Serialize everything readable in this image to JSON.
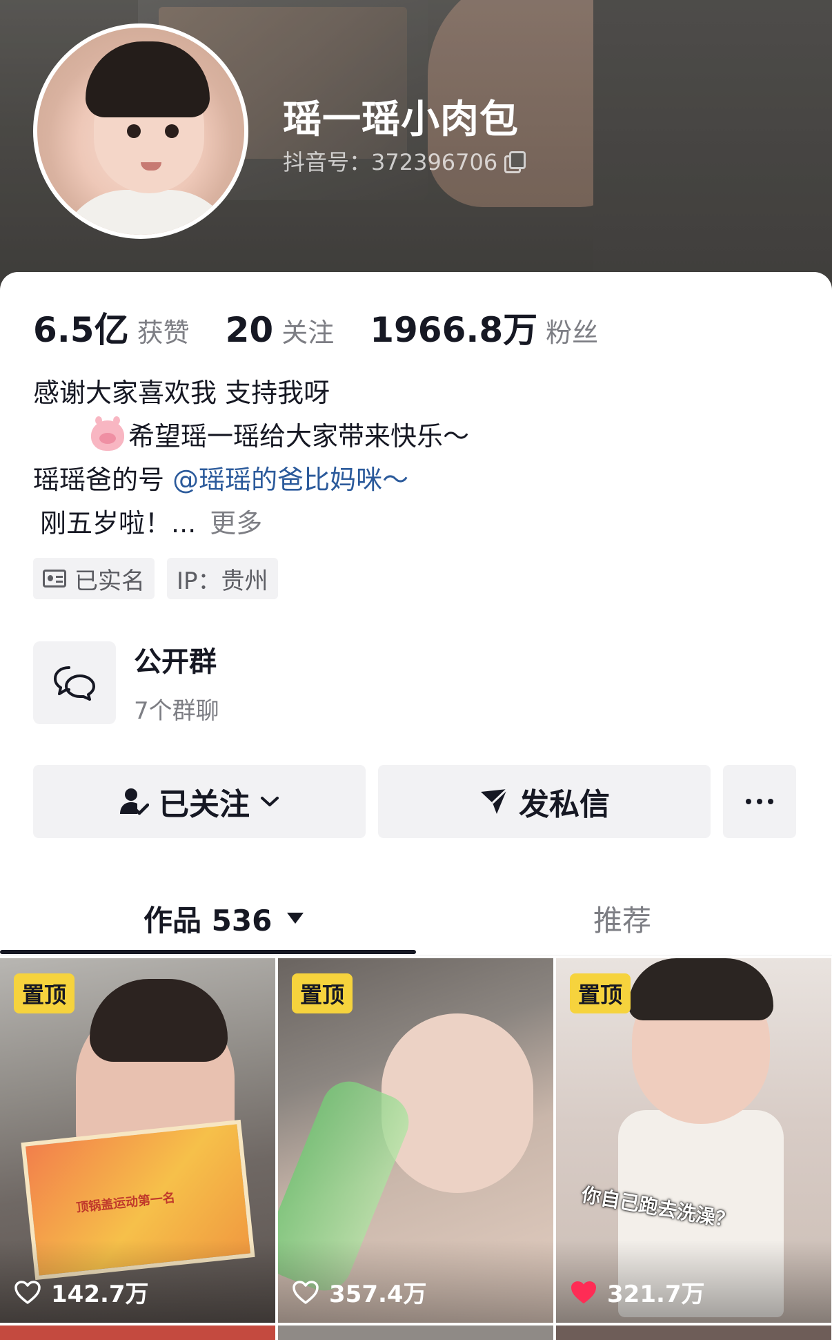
{
  "profile": {
    "name": "瑶一瑶小肉包",
    "douyin_id": "抖音号：372396706"
  },
  "stats": [
    {
      "value": "6.5亿",
      "label": "获赞"
    },
    {
      "value": "20",
      "label": "关注"
    },
    {
      "value": "1966.8万",
      "label": "粉丝"
    }
  ],
  "bio": {
    "line1": "感谢大家喜欢我 支持我呀",
    "line2": "希望瑶一瑶给大家带来快乐～",
    "line3_prefix": "瑶瑶爸的号 ",
    "line3_mention": "@瑶瑶的爸比妈咪～",
    "line4": "刚五岁啦！...",
    "more": "更多"
  },
  "tags": {
    "verified": "已实名",
    "ip": "IP：贵州"
  },
  "group": {
    "title": "公开群",
    "subtitle": "7个群聊"
  },
  "actions": {
    "follow": "已关注",
    "message": "发私信"
  },
  "tabs": {
    "works": "作品 536",
    "recommend": "推荐"
  },
  "videos": [
    {
      "badge": "置顶",
      "likes": "142.7万",
      "liked": false,
      "cert_text": "顶锅盖运动第一名"
    },
    {
      "badge": "置顶",
      "likes": "357.4万",
      "liked": false
    },
    {
      "badge": "置顶",
      "likes": "321.7万",
      "liked": true,
      "caption": "你自己跑去洗澡？"
    }
  ],
  "colors": {
    "accent_mention": "#2b5a9b",
    "pin_badge": "#f6d33d",
    "heart_liked": "#fe2c55"
  }
}
